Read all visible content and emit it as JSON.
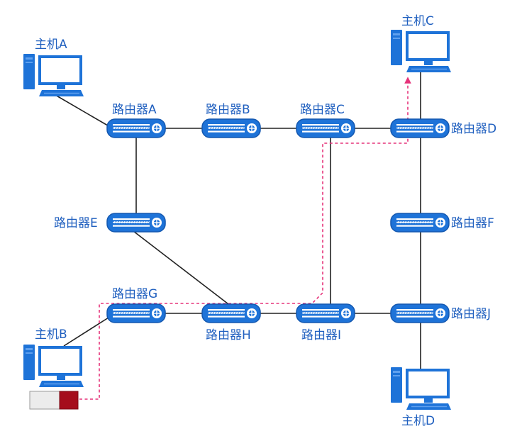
{
  "hosts": [
    {
      "id": "A",
      "label": "主机A"
    },
    {
      "id": "B",
      "label": "主机B"
    },
    {
      "id": "C",
      "label": "主机C"
    },
    {
      "id": "D",
      "label": "主机D"
    }
  ],
  "routers": [
    {
      "id": "A",
      "label": "路由器A"
    },
    {
      "id": "B",
      "label": "路由器B"
    },
    {
      "id": "C",
      "label": "路由器C"
    },
    {
      "id": "D",
      "label": "路由器D"
    },
    {
      "id": "E",
      "label": "路由器E"
    },
    {
      "id": "F",
      "label": "路由器F"
    },
    {
      "id": "G",
      "label": "路由器G"
    },
    {
      "id": "H",
      "label": "路由器H"
    },
    {
      "id": "I",
      "label": "路由器I"
    },
    {
      "id": "J",
      "label": "路由器J"
    }
  ],
  "links": [
    [
      "host-A",
      "router-A"
    ],
    [
      "router-A",
      "router-B"
    ],
    [
      "router-B",
      "router-C"
    ],
    [
      "router-C",
      "router-D"
    ],
    [
      "router-A",
      "router-E"
    ],
    [
      "router-E",
      "router-H"
    ],
    [
      "router-G",
      "router-H"
    ],
    [
      "router-H",
      "router-I"
    ],
    [
      "router-I",
      "router-J"
    ],
    [
      "router-I",
      "router-C"
    ],
    [
      "router-D",
      "router-F"
    ],
    [
      "router-F",
      "router-J"
    ],
    [
      "router-J",
      "host-D"
    ],
    [
      "router-D",
      "host-C"
    ],
    [
      "router-G",
      "host-B"
    ]
  ],
  "path_route": [
    "host-B",
    "router-G",
    "router-H",
    "router-I",
    "router-C",
    "router-D",
    "host-C"
  ],
  "colors": {
    "device_blue": "#1e73d8",
    "label_blue": "#1f5fbf",
    "link": "#222222",
    "path": "#e6337a",
    "packet_red": "#a50d1c"
  }
}
